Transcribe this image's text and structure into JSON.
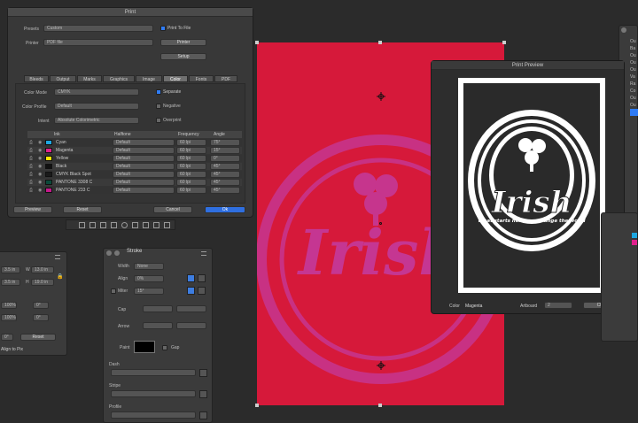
{
  "print": {
    "title": "Print",
    "presets_label": "Presets",
    "presets_value": "Custom",
    "printer_label": "Printer",
    "printer_value": "PDF file",
    "print_to_file": "Print To File",
    "printer_btn": "Printer",
    "setup_btn": "Setup",
    "tabs": [
      "Bleeds",
      "Output",
      "Marks",
      "Graphics",
      "Image",
      "Color",
      "Fonts",
      "PDF"
    ],
    "color_mode_label": "Color Mode",
    "color_mode_value": "CMYK",
    "color_profile_label": "Color Profile",
    "color_profile_value": "Default",
    "intent_label": "Intent",
    "intent_value": "Absolute Colorimetric",
    "separate": "Separate",
    "negative": "Negative",
    "overprint": "Overprint",
    "table_headers": [
      "Ink",
      "Halftone",
      "Frequency",
      "Angle"
    ],
    "inks": [
      {
        "name": "Cyan",
        "color": "#1ea7e1",
        "halftone": "Default",
        "freq": "60 lpi",
        "angle": "75°"
      },
      {
        "name": "Magenta",
        "color": "#e0208c",
        "halftone": "Default",
        "freq": "60 lpi",
        "angle": "15°"
      },
      {
        "name": "Yellow",
        "color": "#ffe600",
        "halftone": "Default",
        "freq": "60 lpi",
        "angle": "0°"
      },
      {
        "name": "Black",
        "color": "#111111",
        "halftone": "Default",
        "freq": "60 lpi",
        "angle": "45°"
      },
      {
        "name": "CMYK Black Spot",
        "color": "#1a1a1a",
        "halftone": "Default",
        "freq": "60 lpi",
        "angle": "45°"
      },
      {
        "name": "PANTONE 3308 C",
        "color": "#0b4a3a",
        "halftone": "Default",
        "freq": "60 lpi",
        "angle": "45°"
      },
      {
        "name": "PANTONE 233 C",
        "color": "#c5198a",
        "halftone": "Default",
        "freq": "60 lpi",
        "angle": "45°"
      }
    ],
    "preview_btn": "Preview",
    "reset_btn": "Reset",
    "cancel_btn": "Cancel",
    "ok_btn": "Ok"
  },
  "transform": {
    "x_value": "3.5 in",
    "w_label": "W",
    "w_value": "13.0 in",
    "y_value": "3.5 in",
    "h_label": "H",
    "h_value": "19.0 in",
    "scale_x": "100%",
    "scale_y": "100%",
    "rot_1": "0°",
    "rot_2": "0°",
    "angle": "0°",
    "reset": "Reset",
    "align_pixels": "Align to Pix"
  },
  "stroke": {
    "title": "Stroke",
    "width_label": "Width",
    "width_value": "None",
    "align_label": "Align",
    "align_value": "0%",
    "miter_label": "Miter",
    "miter_value": "15°",
    "cap_label": "Cap",
    "arrow_label": "Arrow",
    "paint_label": "Paint",
    "gap_label": "Gap",
    "dash_label": "Dash",
    "stripe_label": "Stripe",
    "profile_label": "Profile"
  },
  "artwork": {
    "title_text": "Irish",
    "tagline": "What starts here can change the world"
  },
  "preview": {
    "title": "Print Preview",
    "color_label": "Color",
    "color_value": "Magenta",
    "artboard_label": "Artboard",
    "artboard_value": "2",
    "close_btn": "Close"
  },
  "right_panel": {
    "items": [
      "Ou",
      "Ba",
      "Ou",
      "Ou",
      "Ou",
      "Va",
      "Ra",
      "Co",
      "Ou",
      "Ou"
    ]
  },
  "colors": {
    "artboard": "#d6193a",
    "accent": "#2f7cf6",
    "ok_button": "#2f6fe0",
    "magenta_ink": "#c43a9c"
  }
}
